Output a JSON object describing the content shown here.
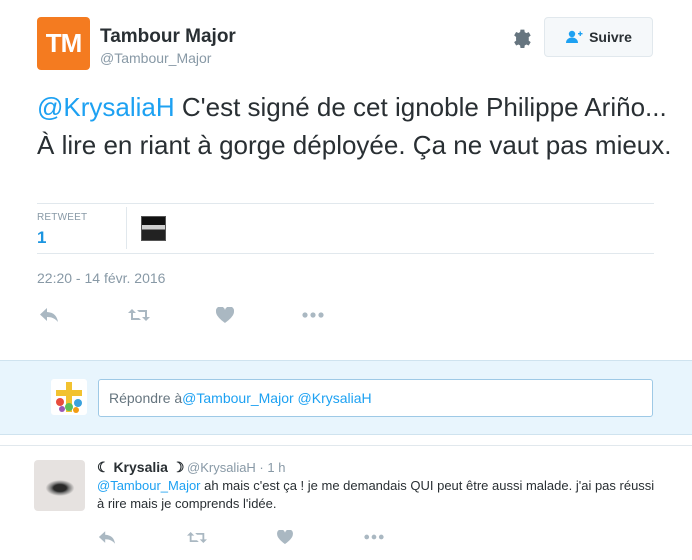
{
  "tweet": {
    "avatar_text": "TM",
    "author_name": "Tambour Major",
    "author_handle": "@Tambour_Major",
    "follow_label": "Suivre",
    "text_mention": "@KrysaliaH",
    "text_body": " C'est signé de cet ignoble Philippe Ariño... À lire en riant à gorge déployée. Ça ne vaut pas mieux.",
    "retweet_label": "RETWEET",
    "retweet_count": "1",
    "timestamp": "22:20 - 14 févr. 2016",
    "actions": [
      "reply-icon",
      "retweet-icon",
      "like-icon",
      "more-icon"
    ]
  },
  "reply_box": {
    "prefix": "Répondre à ",
    "mention_1": "@Tambour_Major",
    "mention_2": "@KrysaliaH"
  },
  "reply_tweet": {
    "author_name": "☾ Krysalia ☽",
    "author_handle": "@KrysaliaH · 1 h",
    "mention": "@Tambour_Major",
    "text": " ah mais c'est ça ! je me demandais QUI peut être aussi malade. j'ai pas réussi à rire mais je comprends l'idée.",
    "actions": [
      "reply-icon",
      "retweet-icon",
      "like-icon",
      "more-icon"
    ]
  },
  "colors": {
    "brand_orange": "#f47b20",
    "link_blue": "#1da1f2",
    "muted_gray": "#8899a6",
    "reply_bg": "#e8f5fd"
  }
}
